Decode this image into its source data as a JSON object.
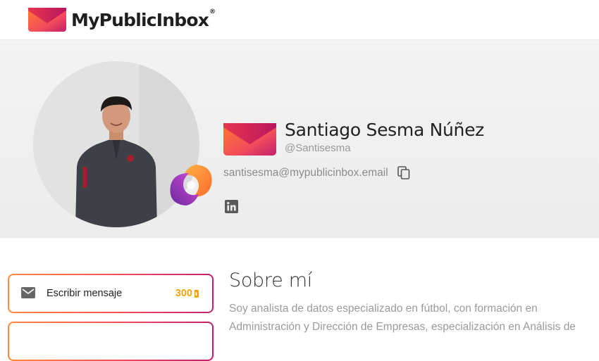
{
  "header": {
    "logo_text": "MyPublicInbox",
    "logo_reg": "®",
    "logo_icon": "mypublicinbox-envelope-logo"
  },
  "profile": {
    "name": "Santiago Sesma Núñez",
    "handle": "@Santisesma",
    "email": "santisesma@mypublicinbox.email",
    "avatar_icon": "profile-photo",
    "badge_icon": "orange-purple-swirl-badge",
    "social": [
      "linkedin"
    ]
  },
  "actions": {
    "write_message": {
      "label": "Escribir mensaje",
      "price": "300",
      "icon": "mail-icon",
      "currency_icon": "coin-icon"
    }
  },
  "about": {
    "title": "Sobre mí",
    "lines": [
      "Soy analista de datos especializado en fútbol, con formación en",
      "Administración y Dirección de Empresas, especialización en Análisis de"
    ]
  },
  "colors": {
    "brand_orange": "#ff8a3c",
    "brand_red": "#f24d5b",
    "brand_magenta": "#c21f6d",
    "price": "#f5a100"
  }
}
